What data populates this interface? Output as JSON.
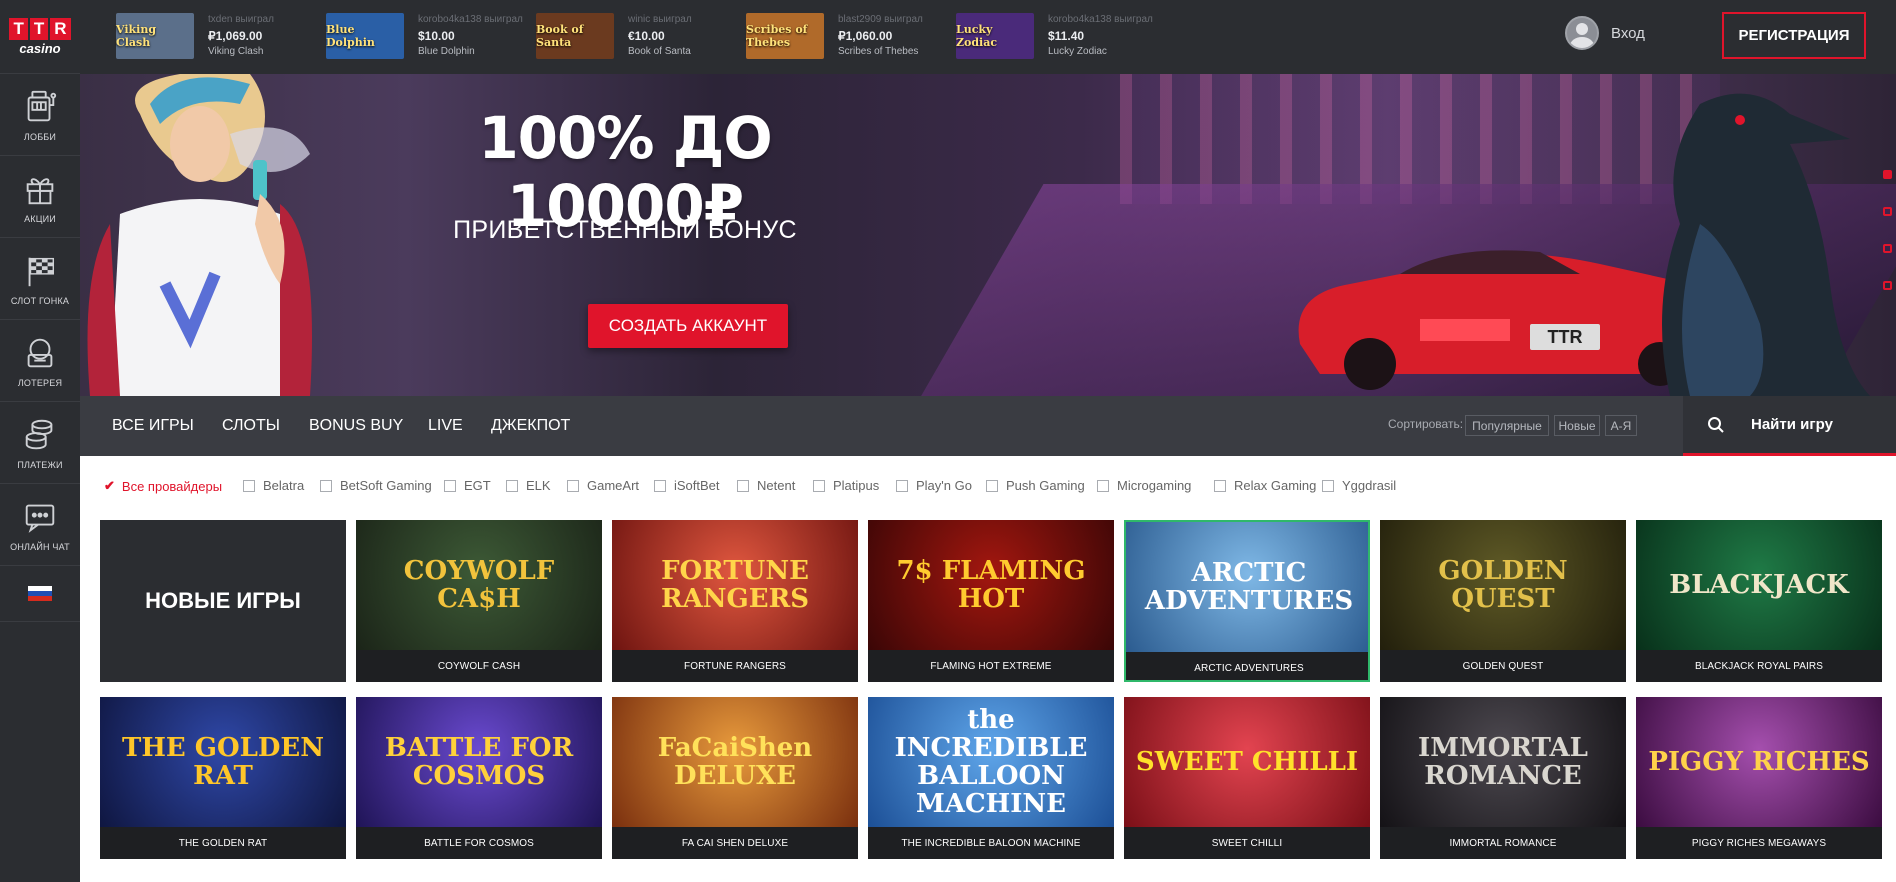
{
  "sidebar": {
    "logo": {
      "letters": [
        "T",
        "T",
        "R"
      ],
      "sub": "casino"
    },
    "items": [
      {
        "label": "ЛОББИ",
        "icon": "slot-machine-icon"
      },
      {
        "label": "АКЦИИ",
        "icon": "gift-icon"
      },
      {
        "label": "СЛОТ ГОНКА",
        "icon": "checkered-flag-icon"
      },
      {
        "label": "ЛОТЕРЕЯ",
        "icon": "lottery-icon"
      },
      {
        "label": "ПЛАТЕЖИ",
        "icon": "coins-icon"
      },
      {
        "label": "ОНЛАЙН ЧАТ",
        "icon": "chat-icon"
      }
    ],
    "language_flag": "russia-flag-icon"
  },
  "header": {
    "winners": [
      {
        "user": "txden выиграл",
        "amount": "₽1,069.00",
        "game": "Viking Clash",
        "thumb": "Viking Clash",
        "color": "#5b6f8a"
      },
      {
        "user": "korobo4ka138 выиграл",
        "amount": "$10.00",
        "game": "Blue Dolphin",
        "thumb": "Blue Dolphin",
        "color": "#2a5fa6"
      },
      {
        "user": "winic выиграл",
        "amount": "€10.00",
        "game": "Book of Santa",
        "thumb": "Book of Santa",
        "color": "#6b3a1f"
      },
      {
        "user": "blast2909 выиграл",
        "amount": "₽1,060.00",
        "game": "Scribes of Thebes",
        "thumb": "Scribes of Thebes",
        "color": "#b06a2a"
      },
      {
        "user": "korobo4ka138 выиграл",
        "amount": "$11.40",
        "game": "Lucky Zodiac",
        "thumb": "Lucky Zodiac",
        "color": "#4a2a7a"
      }
    ],
    "login_label": "Вход",
    "register_label": "РЕГИСТРАЦИЯ"
  },
  "banner": {
    "title": "100% ДО 10000₽",
    "subtitle": "ПРИВЕТСТВЕННЫЙ БОНУС",
    "cta_label": "СОЗДАТЬ АККАУНТ",
    "plate_text": "TTR"
  },
  "nav": {
    "tabs": [
      "ВСЕ ИГРЫ",
      "СЛОТЫ",
      "BONUS BUY",
      "LIVE",
      "ДЖЕКПОТ"
    ],
    "sort_label": "Сортировать:",
    "sort_options": [
      "Популярные",
      "Новые",
      "А-Я"
    ],
    "search_label": "Найти игру"
  },
  "providers": [
    {
      "label": "Все провайдеры",
      "checked": true
    },
    {
      "label": "Belatra",
      "checked": false
    },
    {
      "label": "BetSoft Gaming",
      "checked": false
    },
    {
      "label": "EGT",
      "checked": false
    },
    {
      "label": "ELK",
      "checked": false
    },
    {
      "label": "GameArt",
      "checked": false
    },
    {
      "label": "iSoftBet",
      "checked": false
    },
    {
      "label": "Netent",
      "checked": false
    },
    {
      "label": "Platipus",
      "checked": false
    },
    {
      "label": "Play'n Go",
      "checked": false
    },
    {
      "label": "Push Gaming",
      "checked": false
    },
    {
      "label": "Microgaming",
      "checked": false
    },
    {
      "label": "Relax Gaming",
      "checked": false
    },
    {
      "label": "Yggdrasil",
      "checked": false
    }
  ],
  "games": {
    "new_games_label": "НОВЫЕ ИГРЫ",
    "row1": [
      {
        "name": "COYWOLF CASH",
        "art": "COYWOLF CA$H",
        "bg": "#2b3a2a",
        "fg": "#f2c33c"
      },
      {
        "name": "FORTUNE RANGERS",
        "art": "FORTUNE RANGERS",
        "bg": "#c0392b",
        "fg": "#ffd54a"
      },
      {
        "name": "FLAMING HOT EXTREME",
        "art": "7$ FLAMING HOT",
        "bg": "#6e0d0d",
        "fg": "#ffcb2f"
      },
      {
        "name": "ARCTIC ADVENTURES",
        "art": "ARCTIC ADVENTURES",
        "bg": "#3f7fb8",
        "fg": "#ffffff"
      },
      {
        "name": "GOLDEN QUEST",
        "art": "GOLDEN QUEST",
        "bg": "#3d3a18",
        "fg": "#e2c04a"
      },
      {
        "name": "BLACKJACK ROYAL PAIRS",
        "art": "BLACKJACK",
        "bg": "#0f4a2a",
        "fg": "#f0e6c8"
      }
    ],
    "row2": [
      {
        "name": "THE GOLDEN RAT",
        "art": "THE GOLDEN RAT",
        "bg": "#1a2a6e",
        "fg": "#ffc629"
      },
      {
        "name": "BATTLE FOR COSMOS",
        "art": "BATTLE FOR COSMOS",
        "bg": "#3b2a8a",
        "fg": "#ffd13b"
      },
      {
        "name": "FA CAI SHEN DELUXE",
        "art": "FaCaiShen DELUXE",
        "bg": "#b8551e",
        "fg": "#ffe15a"
      },
      {
        "name": "THE INCREDIBLE BALOON MACHINE",
        "art": "the INCREDIBLE BALLOON MACHINE",
        "bg": "#2a6fc0",
        "fg": "#ffffff"
      },
      {
        "name": "SWEET CHILLI",
        "art": "SWEET CHILLI",
        "bg": "#c21f2a",
        "fg": "#ffe12b"
      },
      {
        "name": "IMMORTAL ROMANCE",
        "art": "IMMORTAL ROMANCE",
        "bg": "#2c2a2e",
        "fg": "#d9d6cf"
      },
      {
        "name": "PIGGY RICHES MEGAWAYS",
        "art": "PIGGY RICHES",
        "bg": "#6a1f6e",
        "fg": "#ffd24a"
      }
    ]
  }
}
